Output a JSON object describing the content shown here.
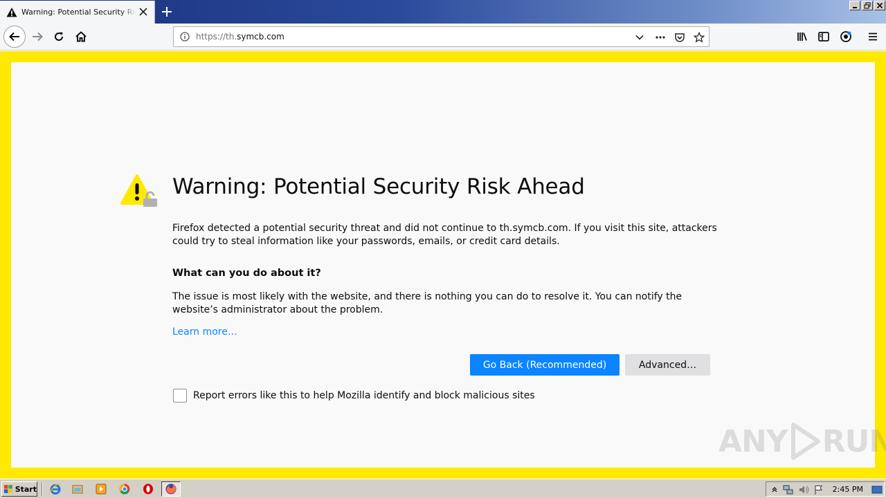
{
  "browser": {
    "tab": {
      "title": "Warning: Potential Security Risk Ahead"
    },
    "url": {
      "scheme": "https://th.",
      "host": "symcb.com"
    }
  },
  "page": {
    "title": "Warning: Potential Security Risk Ahead",
    "intro": "Firefox detected a potential security threat and did not continue to th.symcb.com. If you visit this site, attackers could try to steal information like your passwords, emails, or credit card details.",
    "heading": "What can you do about it?",
    "explanation": "The issue is most likely with the website, and there is nothing you can do to resolve it. You can notify the website’s administrator about the problem.",
    "learn_more": "Learn more…",
    "go_back_label": "Go Back (Recommended)",
    "advanced_label": "Advanced…",
    "report_label": "Report errors like this to help Mozilla identify and block malicious sites"
  },
  "watermark": {
    "left": "ANY",
    "right": "RUN"
  },
  "taskbar": {
    "start_label": "Start",
    "clock": "2:45 PM"
  },
  "colors": {
    "frame": "#ffe900",
    "primary": "#0a84ff",
    "page_bg": "#f9f9fa"
  }
}
